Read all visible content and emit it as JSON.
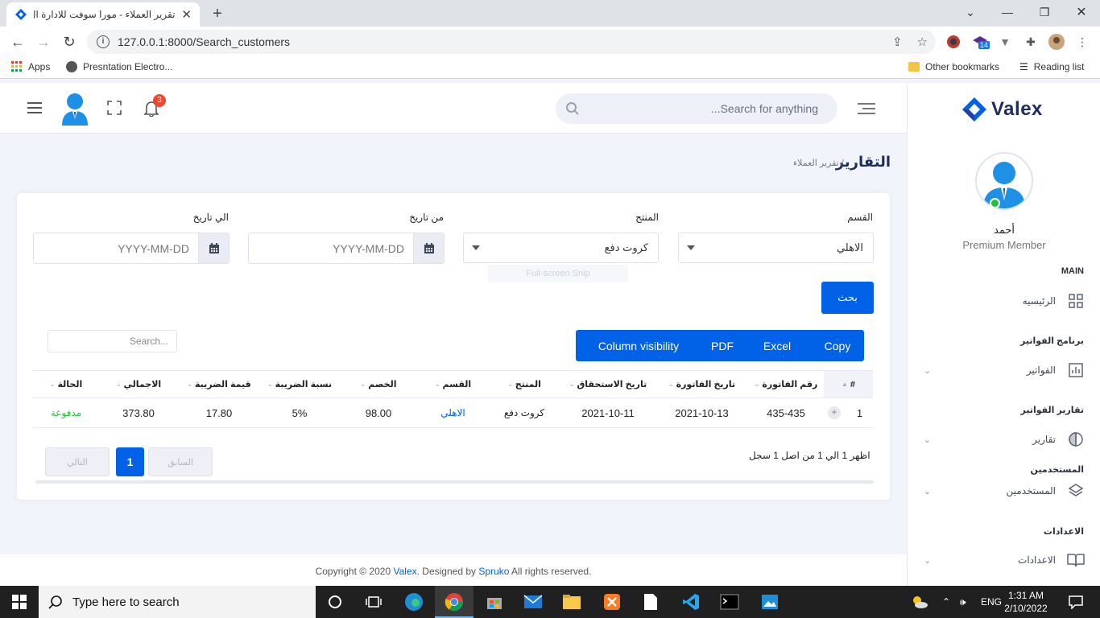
{
  "browser": {
    "tab_title": "تقرير العملاء - مورا سوفت للادارة ال",
    "url": "127.0.0.1:8000/Search_customers",
    "bookmarks": {
      "apps": "Apps",
      "presentation": "Presntation Electro...",
      "other": "Other bookmarks",
      "reading_list": "Reading list"
    },
    "ext_badge": "14"
  },
  "header": {
    "search_placeholder": "Search for anything...",
    "notification_count": "3"
  },
  "sidebar": {
    "brand": "Valex",
    "user_name": "أحمد",
    "user_role": "Premium Member",
    "sections": {
      "main": "MAIN",
      "invoices_program": "برنامج الفواتير",
      "invoice_reports": "تقارير الفواتير",
      "users": "المستخدمين",
      "settings": "الاعدادات"
    },
    "items": {
      "home": "الرئيسيه",
      "invoices": "الفواتير",
      "reports": "تقارير",
      "users": "المستخدمين",
      "settings": "الاعدادات"
    }
  },
  "page": {
    "title": "التقارير",
    "breadcrumb": "/ تقرير العملاء"
  },
  "filters": {
    "section_label": "القسم",
    "section_value": "الاهلي",
    "product_label": "المنتج",
    "product_value": "كروت دفع",
    "from_label": "من تاريخ",
    "from_placeholder": "YYYY-MM-DD",
    "to_label": "الي تاريخ",
    "to_placeholder": "YYYY-MM-DD",
    "search_button": "بحث",
    "snip_hint": "Full-screen Snip"
  },
  "table": {
    "buttons": [
      "Copy",
      "Excel",
      "PDF",
      "Column visibility"
    ],
    "search_placeholder": "Search...",
    "headers": {
      "num": "#",
      "invoice_number": "رقم الفاتورة",
      "invoice_date": "تاريخ الفاتورة",
      "due_date": "تاريخ الاستحقاق",
      "product": "المنتج",
      "section": "القسم",
      "discount": "الخصم",
      "tax_rate": "نسبة الضريبة",
      "tax_value": "قيمة الضريبة",
      "total": "الاجمالي",
      "status": "الحالة"
    },
    "rows": [
      {
        "num": "1",
        "invoice_number": "435-435",
        "invoice_date": "2021-10-13",
        "due_date": "2021-10-11",
        "product": "كروت دفع",
        "section": "الاهلي",
        "discount": "98.00",
        "tax_rate": "5%",
        "tax_value": "17.80",
        "total": "373.80",
        "status": "مدفوعة"
      }
    ],
    "info": "اظهر 1 الي 1 من اصل 1 سجل",
    "pagination": {
      "previous": "السابق",
      "current": "1",
      "next": "التالي"
    }
  },
  "footer": {
    "prefix": "Copyright © 2020 ",
    "brand": "Valex",
    "middle": ". Designed by ",
    "designer": "Spruko",
    "suffix": " All rights reserved."
  },
  "taskbar": {
    "search_placeholder": "Type here to search",
    "language": "ENG",
    "time": "1:31 AM",
    "date": "2/10/2022"
  },
  "colors": {
    "primary": "#0162e8",
    "status_paid": "#22c03c",
    "link_section": "#0162e8",
    "badge": "#f7442e"
  }
}
